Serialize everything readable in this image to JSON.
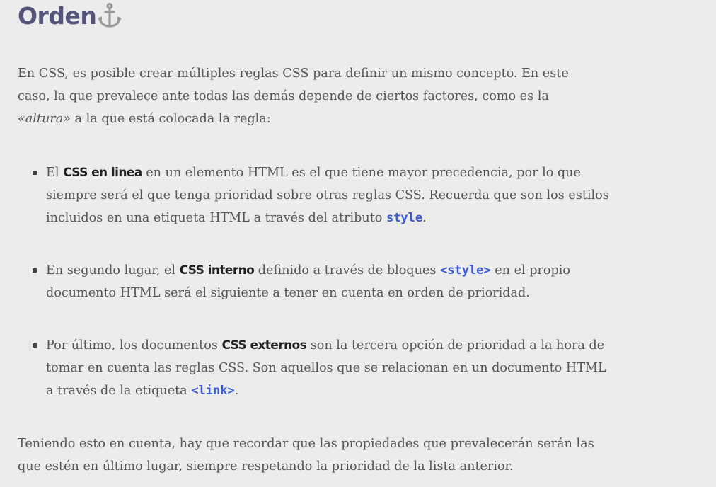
{
  "heading": {
    "title": "Orden"
  },
  "intro": {
    "text1": "En CSS, es posible crear múltiples reglas CSS para definir un mismo concepto. En este caso, la que prevalece ante todas las demás depende de ciertos factores, como es la ",
    "em": "«altura»",
    "text2": " a la que está colocada la regla:"
  },
  "list": [
    {
      "pre": "El ",
      "strong": "CSS en linea",
      "mid": " en un elemento HTML es el que tiene mayor precedencia, por lo que siempre será el que tenga prioridad sobre otras reglas CSS. Recuerda que son los estilos incluidos en una etiqueta HTML a través del atributo ",
      "code": "style",
      "post": "."
    },
    {
      "pre": "En segundo lugar, el ",
      "strong": "CSS interno",
      "mid": " definido a través de bloques ",
      "code": "<style>",
      "post": " en el propio documento HTML será el siguiente a tener en cuenta en orden de prioridad."
    },
    {
      "pre": "Por último, los documentos ",
      "strong": "CSS externos",
      "mid": " son la tercera opción de prioridad a la hora de tomar en cuenta las reglas CSS. Son aquellos que se relacionan en un documento HTML a través de la etiqueta ",
      "code": "<link>",
      "post": "."
    }
  ],
  "outro": {
    "text": "Teniendo esto en cuenta, hay que recordar que las propiedades que prevalecerán serán las que estén en último lugar, siempre respetando la prioridad de la lista anterior."
  },
  "icons": {
    "anchor": "anchor-icon"
  },
  "colors": {
    "heading": "#545379",
    "code": "#3b5bd6",
    "background": "#ececec"
  }
}
